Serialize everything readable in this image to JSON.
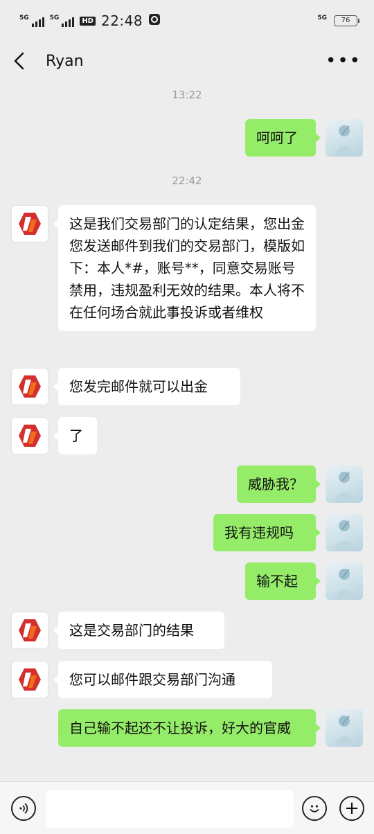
{
  "status_bar": {
    "sig1_label": "5G",
    "sig2_label": "5G",
    "hd_label": "HD",
    "time": "22:48",
    "net_label": "5G",
    "battery": "76"
  },
  "nav": {
    "title": "Ryan",
    "more_label": "•••"
  },
  "chat": {
    "timestamps": [
      "13:22",
      "22:42"
    ],
    "messages": [
      {
        "from": "me",
        "text": "呵呵了"
      },
      {
        "from": "them",
        "text": "这是我们交易部门的认定结果，您出金您发送邮件到我们的交易部门，模版如下：本人*#，账号**，同意交易账号禁用，违规盈利无效的结果。本人将不在任何场合就此事投诉或者维权"
      },
      {
        "from": "them",
        "text": "您发完邮件就可以出金"
      },
      {
        "from": "them",
        "text": "了"
      },
      {
        "from": "me",
        "text": "威胁我？"
      },
      {
        "from": "me",
        "text": "我有违规吗"
      },
      {
        "from": "me",
        "text": "输不起"
      },
      {
        "from": "them",
        "text": "这是交易部门的结果"
      },
      {
        "from": "them",
        "text": "您可以邮件跟交易部门沟通"
      },
      {
        "from": "me",
        "text": "自己输不起还不让投诉，好大的官威"
      }
    ]
  },
  "input_bar": {
    "placeholder": "",
    "plus_label": "+"
  },
  "colors": {
    "background": "#ededed",
    "my_bubble": "#95ec69",
    "their_bubble": "#ffffff",
    "logo_red": "#d32f2f",
    "logo_orange": "#ef6c1a"
  },
  "icons": {
    "back": "chevron-left-icon",
    "voice": "voice-icon",
    "emoji": "emoji-icon",
    "plus": "plus-icon",
    "sender_avatar": "company-logo-avatar",
    "my_avatar": "user-photo-avatar"
  }
}
